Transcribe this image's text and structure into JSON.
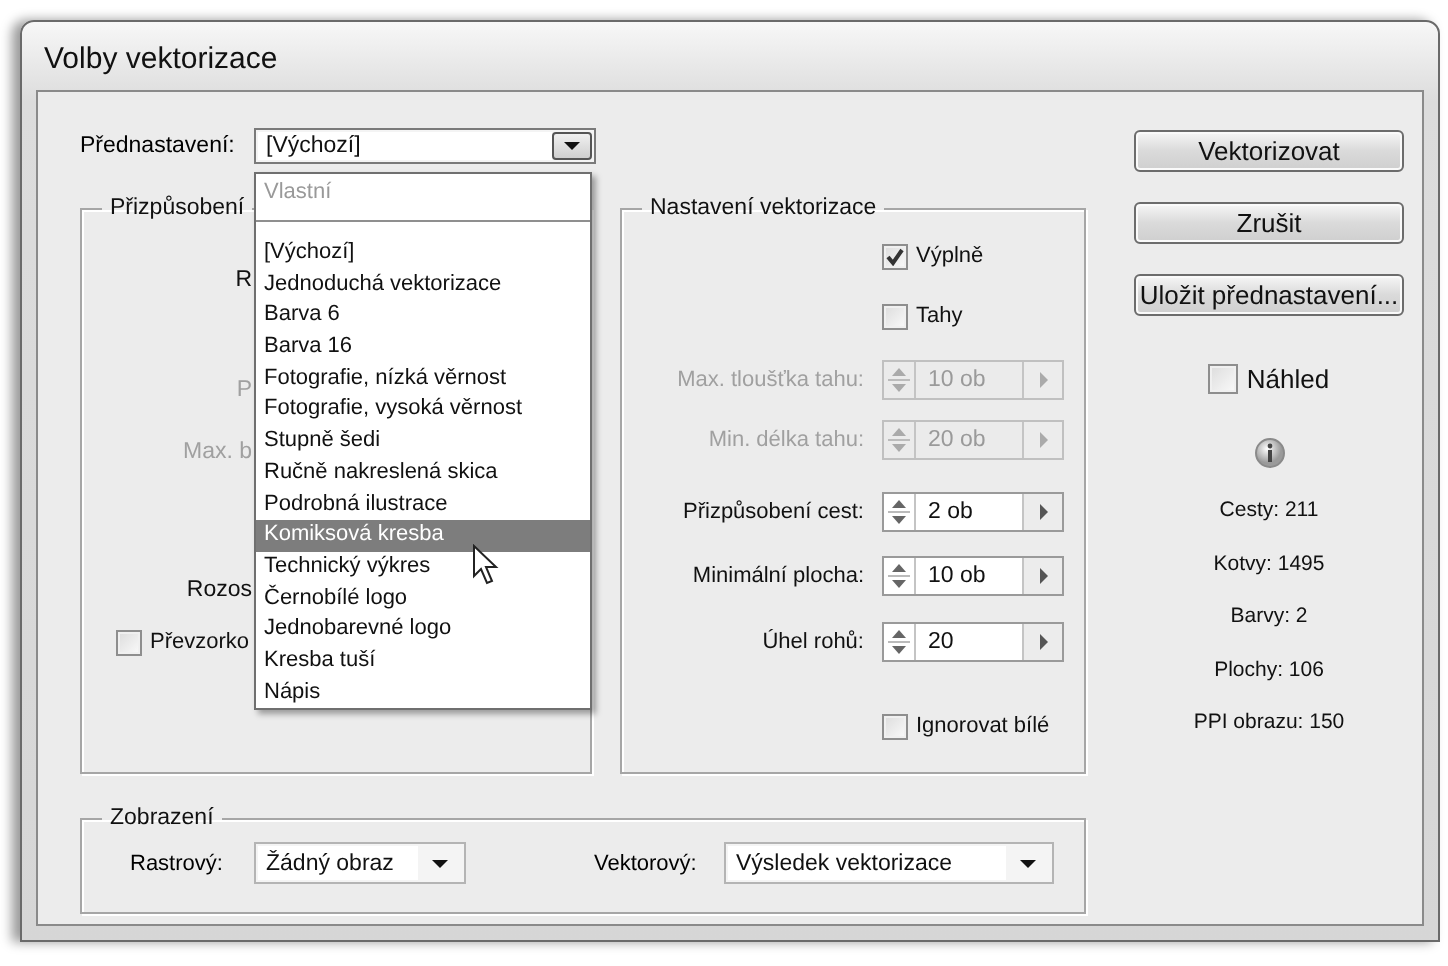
{
  "window": {
    "title": "Volby vektorizace"
  },
  "preset": {
    "label": "Přednastavení:",
    "value": "[Výchozí]",
    "expanded": true
  },
  "preset_menu": {
    "header": "Vlastní",
    "items": [
      {
        "label": "[Výchozí]",
        "selected": false
      },
      {
        "label": "Jednoduchá vektorizace",
        "selected": false
      },
      {
        "label": "Barva 6",
        "selected": false
      },
      {
        "label": "Barva 16",
        "selected": false
      },
      {
        "label": "Fotografie, nízká věrnost",
        "selected": false
      },
      {
        "label": "Fotografie, vysoká věrnost",
        "selected": false
      },
      {
        "label": "Stupně šedi",
        "selected": false
      },
      {
        "label": "Ručně nakreslená skica",
        "selected": false
      },
      {
        "label": "Podrobná ilustrace",
        "selected": false
      },
      {
        "label": "Komiksová kresba",
        "selected": true
      },
      {
        "label": "Technický výkres",
        "selected": false
      },
      {
        "label": "Černobílé logo",
        "selected": false
      },
      {
        "label": "Jednobarevné logo",
        "selected": false
      },
      {
        "label": "Kresba tuší",
        "selected": false
      },
      {
        "label": "Nápis",
        "selected": false
      }
    ]
  },
  "adjust_group": {
    "title": "Přizpůsobení",
    "labels": [
      {
        "text": "R",
        "disabled": false
      },
      {
        "text": "P",
        "disabled": true
      },
      {
        "text": "Max. b",
        "disabled": true
      },
      {
        "text": "Rozos",
        "disabled": false
      }
    ],
    "checkbox": {
      "label": "Převzorko",
      "checked": false
    }
  },
  "vector_group": {
    "title": "Nastavení vektorizace",
    "checkboxes": [
      {
        "label": "Výplně",
        "checked": true
      },
      {
        "label": "Tahy",
        "checked": false
      }
    ],
    "spinners": [
      {
        "label": "Max. tloušťka tahu:",
        "value": "10 ob",
        "disabled": true
      },
      {
        "label": "Min. délka tahu:",
        "value": "20 ob",
        "disabled": true
      },
      {
        "label": "Přizpůsobení cest:",
        "value": "2 ob",
        "disabled": false
      },
      {
        "label": "Minimální plocha:",
        "value": "10 ob",
        "disabled": false
      },
      {
        "label": "Úhel rohů:",
        "value": "20",
        "disabled": false
      }
    ],
    "ignore_white": {
      "label": "Ignorovat bílé",
      "checked": false
    }
  },
  "buttons": [
    "Vektorizovat",
    "Zrušit",
    "Uložit přednastavení..."
  ],
  "preview": {
    "label": "Náhled",
    "checked": false
  },
  "stats": [
    "Cesty: 211",
    "Kotvy: 1495",
    "Barvy: 2",
    "Plochy: 106",
    "PPI obrazu: 150"
  ],
  "display_group": {
    "title": "Zobrazení",
    "raster": {
      "label": "Rastrový:",
      "value": "Žádný obraz"
    },
    "vector": {
      "label": "Vektorový:",
      "value": "Výsledek vektorizace"
    }
  }
}
